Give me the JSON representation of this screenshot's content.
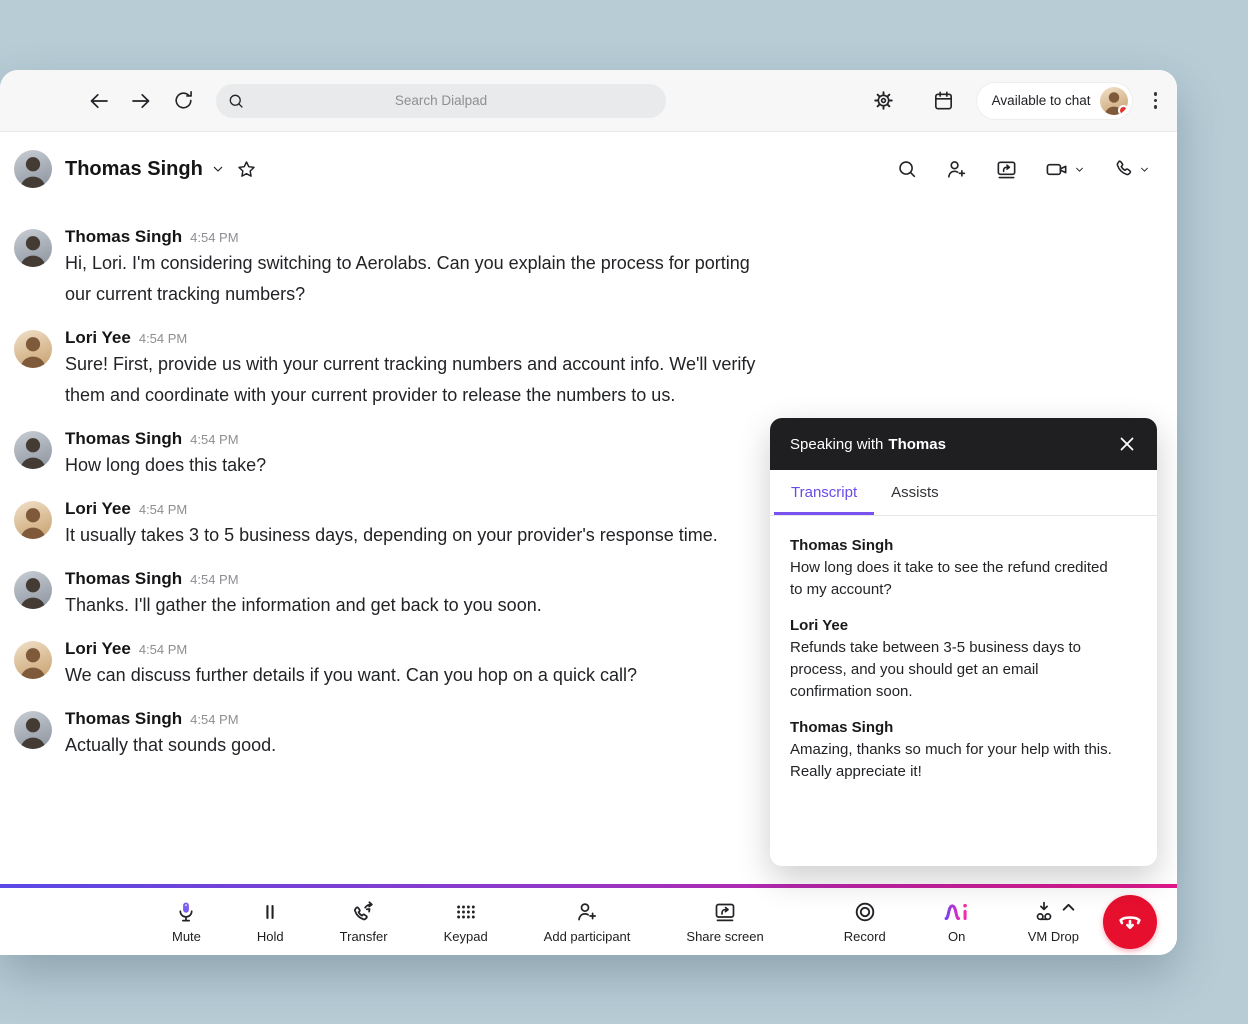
{
  "colors": {
    "accent_purple": "#6a4be8",
    "gradient_start": "#5b49e6",
    "gradient_end": "#e0198a",
    "end_call_red": "#e60f2e",
    "status_dot_red": "#e5322d"
  },
  "topbar": {
    "search_placeholder": "Search Dialpad",
    "availability": "Available to chat"
  },
  "chat_header": {
    "title": "Thomas Singh"
  },
  "messages": [
    {
      "author": "Thomas Singh",
      "time": "4:54 PM",
      "text": "Hi, Lori. I'm considering switching to Aerolabs. Can you explain the process for porting our current tracking numbers?"
    },
    {
      "author": "Lori Yee",
      "time": "4:54 PM",
      "text": "Sure! First, provide us with your current tracking numbers and account info. We'll verify them and coordinate with your current provider to release the numbers to us."
    },
    {
      "author": "Thomas Singh",
      "time": "4:54 PM",
      "text": "How long does this take?"
    },
    {
      "author": "Lori Yee",
      "time": "4:54 PM",
      "text": "It usually takes 3 to 5 business days, depending on your provider's response time."
    },
    {
      "author": "Thomas Singh",
      "time": "4:54 PM",
      "text": "Thanks. I'll gather the information and get back to you soon."
    },
    {
      "author": "Lori Yee",
      "time": "4:54 PM",
      "text": "We can discuss further details if you want. Can you hop on a quick call?"
    },
    {
      "author": "Thomas Singh",
      "time": "4:54 PM",
      "text": "Actually that sounds good."
    }
  ],
  "call_panel": {
    "title_prefix": "Speaking with",
    "title_name": "Thomas",
    "tabs": {
      "transcript": "Transcript",
      "assists": "Assists"
    },
    "transcript": [
      {
        "speaker": "Thomas Singh",
        "text": "How long does it take to see the refund credited to my account?"
      },
      {
        "speaker": "Lori Yee",
        "text": "Refunds take between 3-5 business days to process, and you should get an email confirmation soon."
      },
      {
        "speaker": "Thomas Singh",
        "text": "Amazing, thanks so much for your help with this. Really appreciate it!"
      }
    ]
  },
  "callbar": {
    "mute": "Mute",
    "hold": "Hold",
    "transfer": "Transfer",
    "keypad": "Keypad",
    "add_participant": "Add participant",
    "share_screen": "Share screen",
    "record": "Record",
    "ai_on": "On",
    "vm_drop": "VM Drop"
  }
}
